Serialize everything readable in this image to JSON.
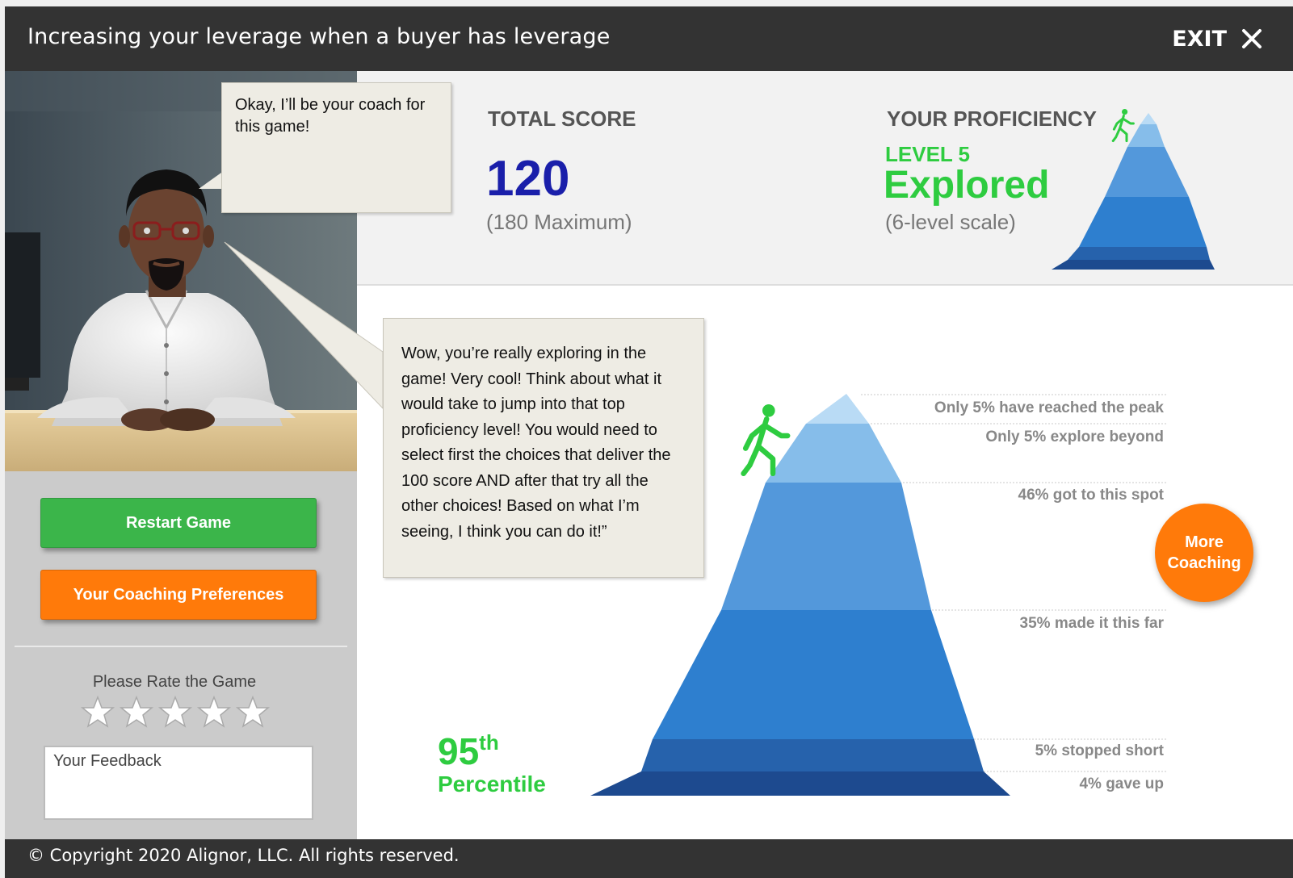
{
  "header": {
    "title": "Increasing your leverage when a buyer has leverage",
    "exit_label": "EXIT"
  },
  "coach": {
    "bubble_1": "Okay, I’ll be your coach for this game!",
    "bubble_2": "Wow, you’re really exploring in the game! Very cool! Think about what it would take to jump into that top proficiency level! You would need to select first the choices that deliver the 100 score AND after that try all the other choices! Based on what I’m seeing, I think you can do it!”"
  },
  "sidebar": {
    "restart_label": "Restart Game",
    "preferences_label": "Your Coaching Preferences",
    "rate_label": "Please Rate the Game",
    "star_count": 5,
    "feedback_placeholder": "Your Feedback"
  },
  "score": {
    "total_header": "TOTAL SCORE",
    "total_value": "120",
    "total_max": "(180 Maximum)",
    "proficiency_header": "YOUR PROFICIENCY",
    "level_label": "LEVEL 5",
    "level_name": "Explored",
    "scale_label": "(6-level scale)"
  },
  "percentile": {
    "number": "95",
    "suffix": "th",
    "word": "Percentile"
  },
  "chart_data": {
    "type": "area",
    "levels": [
      {
        "level": 6,
        "label": "Only 5% have reached the peak",
        "color": "#b9dbf5"
      },
      {
        "level": 5,
        "label": "Only 5% explore beyond",
        "color": "#86bdea",
        "highlight": true
      },
      {
        "level": 4,
        "label": "46% got to this spot",
        "color": "#5398db"
      },
      {
        "level": 3,
        "label": "35% made it this far",
        "color": "#2e7fcf"
      },
      {
        "level": 2,
        "label": "5% stopped short",
        "color": "#2662ac"
      },
      {
        "level": 1,
        "label": "4% gave up",
        "color": "#1d4a8f"
      }
    ],
    "player_level": 5
  },
  "more_coaching_label": "More Coaching",
  "footer": {
    "copyright": "© Copyright 2020 Alignor, LLC. All rights reserved."
  },
  "colors": {
    "title_bar": "#333333",
    "green": "#2ecc40",
    "orange": "#ff7a0a",
    "score_blue": "#1a1faa"
  },
  "icons": {
    "exit": "close-icon",
    "star": "star-icon",
    "climber": "hiker-icon"
  }
}
